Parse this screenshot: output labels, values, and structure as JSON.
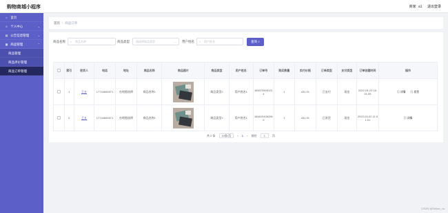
{
  "app": {
    "title": "购物商城小程序"
  },
  "topbar": {
    "user_prefix": "商家",
    "username": "a1",
    "logout": "退出登录"
  },
  "sidebar": {
    "items": [
      {
        "label": "首页",
        "icon": "home-icon",
        "glyph": "⌂"
      },
      {
        "label": "个人中心",
        "icon": "user-icon",
        "glyph": "☺",
        "chev": "⌄"
      },
      {
        "label": "公告信息管理",
        "icon": "notice-icon",
        "glyph": "▤",
        "chev": "⌄"
      },
      {
        "label": "商品管理",
        "icon": "goods-icon",
        "glyph": "▦",
        "chev": "⌃"
      }
    ],
    "sub_items": [
      {
        "label": "商品管理"
      },
      {
        "label": "商品评价管理"
      },
      {
        "label": "商品订单管理"
      }
    ]
  },
  "breadcrumb": {
    "home": "首页",
    "sep": "/",
    "current": "商品订单"
  },
  "filters": {
    "name_label": "商品名称",
    "name_placeholder": "商品名称",
    "type_label": "商品类型",
    "type_placeholder": "请选择商品类型",
    "user_label": "用户姓名",
    "user_placeholder": "用户姓名",
    "query_button": "查询",
    "search_glyph": "⌕",
    "dropdown_glyph": "⌄"
  },
  "table": {
    "headers": [
      "索引",
      "收货人",
      "电话",
      "地址",
      "商品名称",
      "商品图片",
      "商品类型",
      "用户姓名",
      "订单号",
      "购买数量",
      "实付价格",
      "订单类型",
      "支付类型",
      "订单创建时间",
      "操作"
    ],
    "rows": [
      {
        "index": "1",
        "receiver": "王五",
        "phone": "17744684571",
        "address": "在地图选择",
        "goods_name": "商品名称1",
        "goods_type": "商品类型2",
        "user_name": "用户姓名1",
        "order_no": "1650709051214",
        "quantity": "1",
        "price": "431.91",
        "order_type": "已支付",
        "pay_type": "现金",
        "created": "2022-04-23 16:01:05",
        "actions": [
          "详情",
          "发货"
        ]
      },
      {
        "index": "2",
        "receiver": "王五",
        "phone": "17744684571",
        "address": "在地图选择",
        "goods_name": "商品名称1",
        "goods_type": "商品类型2",
        "user_name": "用户姓名1",
        "order_no": "1646191062960",
        "quantity": "1",
        "price": "431.91",
        "order_type": "已发货",
        "pay_type": "现金",
        "created": "2022-03-02 11:31:01",
        "actions": [
          "详情"
        ]
      }
    ]
  },
  "pagination": {
    "total": "共 2 条",
    "page_size": "10条/页",
    "prev": "‹",
    "current_page": "1",
    "next": "›",
    "goto_label": "前往",
    "goto_value": "1",
    "page_suffix": "页"
  },
  "watermark": "CSDN @Seline_xu",
  "colors": {
    "primary": "#5b5fc7",
    "sidebar_active": "#24285f"
  }
}
